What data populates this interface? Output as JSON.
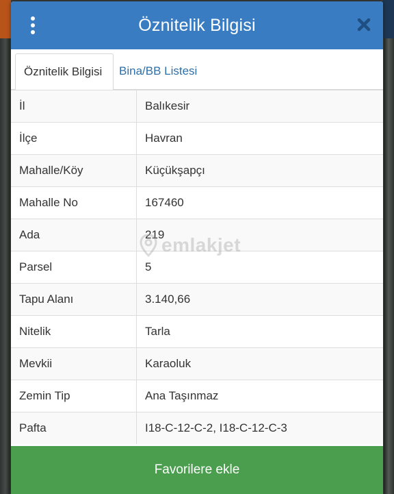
{
  "dialog": {
    "title": "Öznitelik Bilgisi",
    "menu_icon": "more-vertical-icon",
    "close_icon": "close-icon"
  },
  "tabs": [
    {
      "label": "Öznitelik Bilgisi",
      "active": true
    },
    {
      "label": "Bina/BB Listesi",
      "active": false
    }
  ],
  "attributes": [
    {
      "key": "İl",
      "value": "Balıkesir"
    },
    {
      "key": "İlçe",
      "value": "Havran"
    },
    {
      "key": "Mahalle/Köy",
      "value": "Küçükşapçı"
    },
    {
      "key": "Mahalle No",
      "value": "167460"
    },
    {
      "key": "Ada",
      "value": "219"
    },
    {
      "key": "Parsel",
      "value": "5"
    },
    {
      "key": "Tapu Alanı",
      "value": "3.140,66"
    },
    {
      "key": "Nitelik",
      "value": "Tarla"
    },
    {
      "key": "Mevkii",
      "value": "Karaoluk"
    },
    {
      "key": "Zemin Tip",
      "value": "Ana Taşınmaz"
    },
    {
      "key": "Pafta",
      "value": "I18-C-12-C-2, I18-C-12-C-3"
    }
  ],
  "watermark": "emlakjet",
  "footer": {
    "button_label": "Favorilere ekle"
  },
  "colors": {
    "header": "#3a7cc1",
    "tab_link": "#2f6fa8",
    "footer": "#4a9e4e"
  }
}
